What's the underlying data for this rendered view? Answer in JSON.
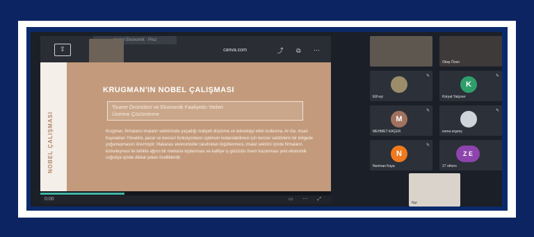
{
  "browser": {
    "tab_label": "Nobel Ekonomik · Prez",
    "url": "canva.com",
    "share_icon": "share-screen-icon"
  },
  "slide": {
    "side_text": "NOBEL ÇALIŞMASI",
    "title": "KRUGMAN'IN NOBEL ÇALIŞMASI",
    "subtitle_line1": "Ticaret Örüntüleri ve Ekonomik Faaliyetin Yerleri",
    "subtitle_line2": "Üzerine Çözümleme",
    "body": "Krugman, firmaların imalatın sektöründe yaşadığı maliyeti düşürme ve teknolojiyi etkin kullanma. Ar-Ge, insan Kaynakları Yönetimi, pazar ve benzeri fonksiyonların optimum kullanılabilmesi için benzer sektörlerin bir bölgede yoğunlaşmasını önermiştir. Makarası ekonomistler tarafından örgütlenmesi, imalat sektörü içinde firmaların kümeleşmesi ile birlikte ağırın bir merkeze toplanması ve kalifiye iş gücünün önem kazanması yeni ekonomik coğrafya içinde dikkat çeken özelliklerdir.",
    "progress": 0.29,
    "time_label": "0:00"
  },
  "participants": [
    {
      "name": "",
      "initial": "",
      "color": "#5e5750"
    },
    {
      "name": "Okay Özen",
      "initial": "",
      "color": "#3e3a3a"
    },
    {
      "name": "Elif eşi",
      "initial": "",
      "color": "#9b8d6a"
    },
    {
      "name": "Küryat Yalçıner",
      "initial": "K",
      "color": "#2e9e6b"
    },
    {
      "name": "MEHMET KAÇER",
      "initial": "M",
      "color": "#a1725e"
    },
    {
      "name": "esma ergenç",
      "initial": "",
      "color": "#cfd3da"
    },
    {
      "name": "Neriman Kaya",
      "initial": "N",
      "color": "#f07a1e"
    },
    {
      "name": "27 others",
      "initial": "Z E",
      "color": "#8e44ad"
    }
  ],
  "bottom_participant": {
    "name": "Nur"
  }
}
